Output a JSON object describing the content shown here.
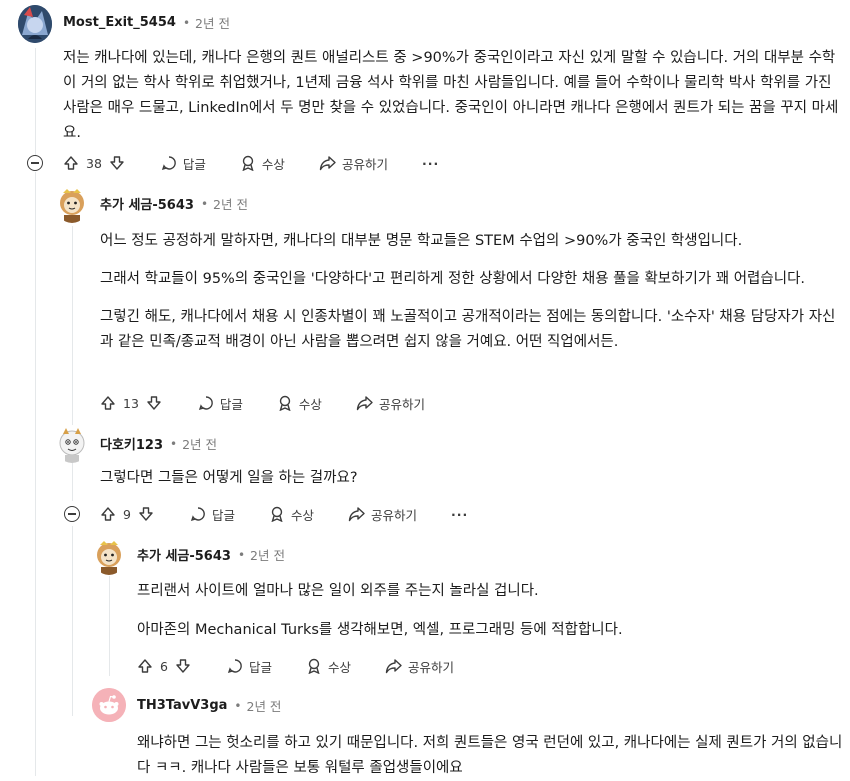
{
  "comments": [
    {
      "author": "Most_Exit_5454",
      "time": "2년 전",
      "paragraphs": [
        "저는 캐나다에 있는데, 캐나다 은행의 퀀트 애널리스트 중 >90%가 중국인이라고 자신 있게 말할 수 있습니다. 거의 대부분 수학이 거의 없는 학사 학위로 취업했거나, 1년제 금융 석사 학위를 마친 사람들입니다. 예를 들어 수학이나 물리학 박사 학위를 가진 사람은 매우 드물고, LinkedIn에서 두 명만 찾을 수 있었습니다. 중국인이 아니라면 캐나다 은행에서 퀀트가 되는 꿈을 꾸지 마세요."
      ],
      "votes": "38"
    },
    {
      "author": "추가 세금-5643",
      "time": "2년 전",
      "paragraphs": [
        "어느 정도 공정하게 말하자면, 캐나다의 대부분 명문 학교들은 STEM 수업의 >90%가 중국인 학생입니다.",
        "그래서 학교들이 95%의 중국인을 '다양하다'고 편리하게 정한 상황에서 다양한 채용 풀을 확보하기가 꽤 어렵습니다.",
        "그렇긴 해도, 캐나다에서 채용 시 인종차별이 꽤 노골적이고 공개적이라는 점에는 동의합니다. '소수자' 채용 담당자가 자신과 같은 민족/종교적 배경이 아닌 사람을 뽑으려면 쉽지 않을 거예요. 어떤 직업에서든."
      ],
      "votes": "13"
    },
    {
      "author": "다호키123",
      "time": "2년 전",
      "paragraphs": [
        "그렇다면 그들은 어떻게 일을 하는 걸까요?"
      ],
      "votes": "9"
    },
    {
      "author": "추가 세금-5643",
      "time": "2년 전",
      "paragraphs": [
        "프리랜서 사이트에 얼마나 많은 일이 외주를 주는지 놀라실 겁니다.",
        "아마존의 Mechanical Turks를 생각해보면, 엑셀, 프로그래밍 등에 적합합니다."
      ],
      "votes": "6"
    },
    {
      "author": "TH3TavV3ga",
      "time": "2년 전",
      "paragraphs": [
        "왜냐하면 그는 헛소리를 하고 있기 때문입니다. 저희 퀀트들은 영국 런던에 있고, 캐나다에는 실제 퀀트가 거의 없습니다 ㅋㅋ. 캐나다 사람들은 보통 워털루 졸업생들이에요"
      ]
    }
  ],
  "actions": {
    "reply": "답글",
    "award": "수상",
    "share": "공유하기",
    "more": "···"
  },
  "icons": [
    "upvote-icon",
    "downvote-icon",
    "reply-icon",
    "award-icon",
    "share-icon",
    "more-icon",
    "collapse-icon"
  ]
}
